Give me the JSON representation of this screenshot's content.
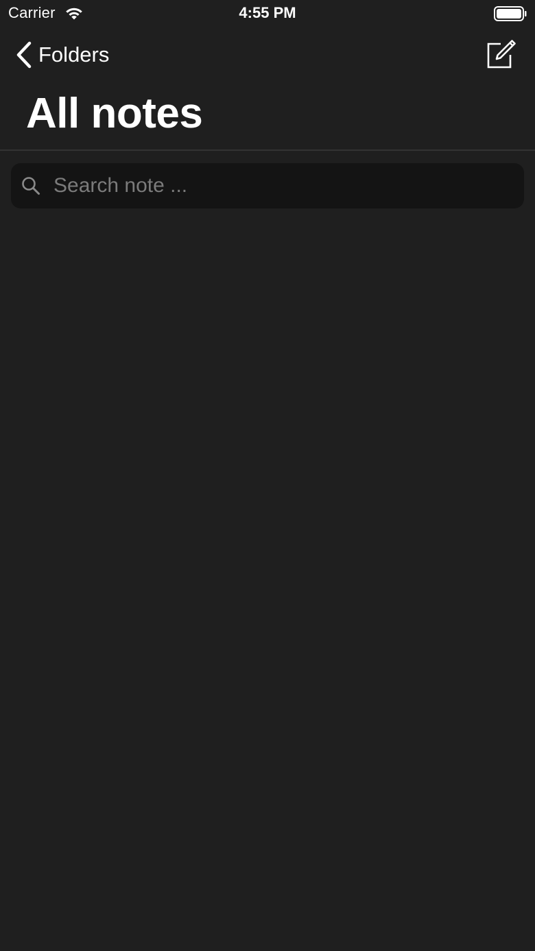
{
  "status_bar": {
    "carrier": "Carrier",
    "time": "4:55 PM",
    "icons": [
      "wifi-icon",
      "battery-icon"
    ]
  },
  "nav_bar": {
    "back_label": "Folders",
    "back_icon": "chevron-left-icon",
    "compose_icon": "compose-icon"
  },
  "page": {
    "title": "All notes"
  },
  "search": {
    "placeholder": "Search note ...",
    "value": "",
    "icon": "search-icon"
  },
  "notes": [],
  "colors": {
    "background": "#1f1f1f",
    "search_background": "#141414",
    "placeholder": "#7b7b7b",
    "text": "#ffffff",
    "divider": "#333333"
  }
}
